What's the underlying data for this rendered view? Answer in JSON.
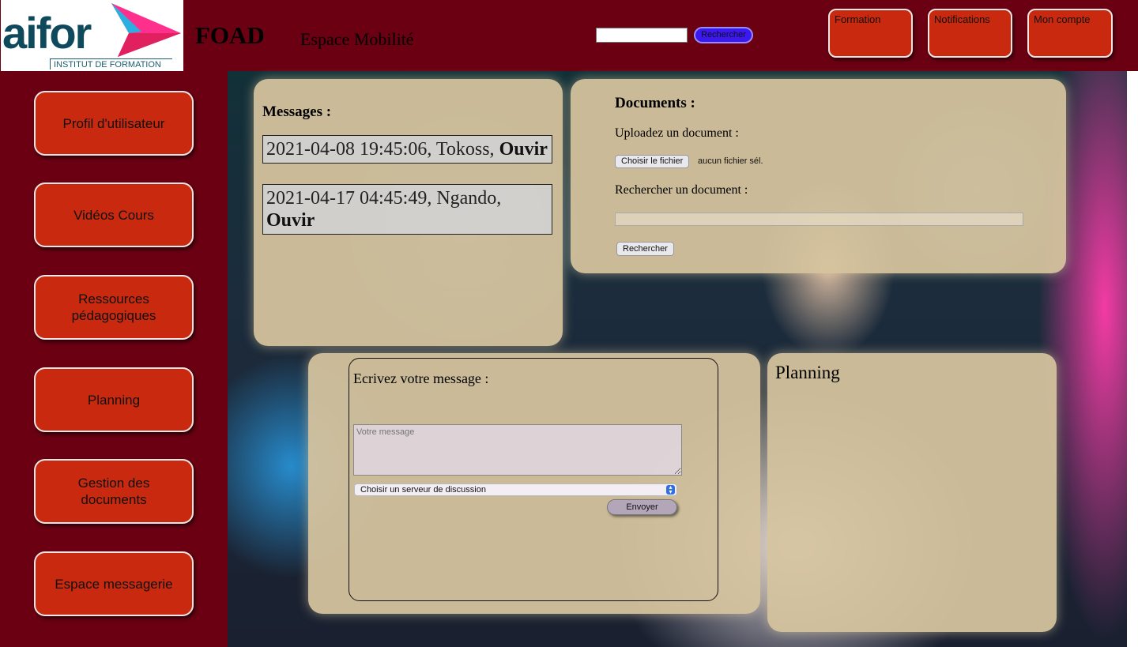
{
  "header": {
    "logo_text": "aifor",
    "logo_subtitle": "INSTITUT DE FORMATION",
    "brand": "FOAD",
    "subtitle": "Espace Mobilité",
    "search_button": "Rechercher",
    "nav": [
      {
        "label": "Formation"
      },
      {
        "label": "Notifications"
      },
      {
        "label": "Mon compte"
      }
    ]
  },
  "sidebar": {
    "items": [
      {
        "label": "Profil d'utilisateur"
      },
      {
        "label": "Vidéos Cours"
      },
      {
        "label": "Ressources pédagogiques"
      },
      {
        "label": "Planning"
      },
      {
        "label": "Gestion des documents"
      },
      {
        "label": "Espace messagerie"
      }
    ]
  },
  "messages": {
    "title": "Messages :",
    "items": [
      {
        "text": "2021-04-08 19:45:06, Tokoss, ",
        "link": "Ouvir"
      },
      {
        "text": "2021-04-17 04:45:49, Ngando, ",
        "link": "Ouvir"
      }
    ]
  },
  "documents": {
    "title": "Documents :",
    "upload_label": "Uploadez un document :",
    "file_button": "Choisir le fichier",
    "file_status": "aucun fichier sél.",
    "search_label": "Rechercher un document :",
    "search_button": "Rechercher"
  },
  "compose": {
    "label": "Ecrivez votre message :",
    "placeholder": "Votre message",
    "server_select": "Choisir un serveur de discussion",
    "send_button": "Envoyer"
  },
  "planning": {
    "title": "Planning"
  },
  "colors": {
    "header_bg": "#6a0012",
    "button_red": "#c8290f",
    "panel_bg": "#d6c49e",
    "search_btn": "#3b17f0"
  }
}
